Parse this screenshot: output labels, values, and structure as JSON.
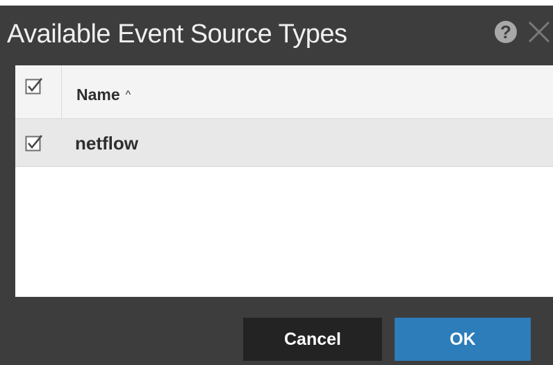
{
  "dialog": {
    "title": "Available Event Source Types",
    "help_icon": "question-circle-icon",
    "help_glyph": "?",
    "close_icon": "close-x-icon"
  },
  "grid": {
    "header": {
      "select_all_checked": true,
      "column_name": "Name",
      "sort_direction": "ascending",
      "sort_glyph": "^"
    },
    "rows": [
      {
        "name": "netflow",
        "checked": true
      }
    ]
  },
  "footer": {
    "cancel_label": "Cancel",
    "ok_label": "OK"
  },
  "colors": {
    "dialog_background": "#3d3d3d",
    "title_text": "#f0f0f0",
    "header_background": "#f4f4f4",
    "row_background": "#e8e8e8",
    "cancel_button": "#232323",
    "ok_button": "#2d7dba"
  }
}
